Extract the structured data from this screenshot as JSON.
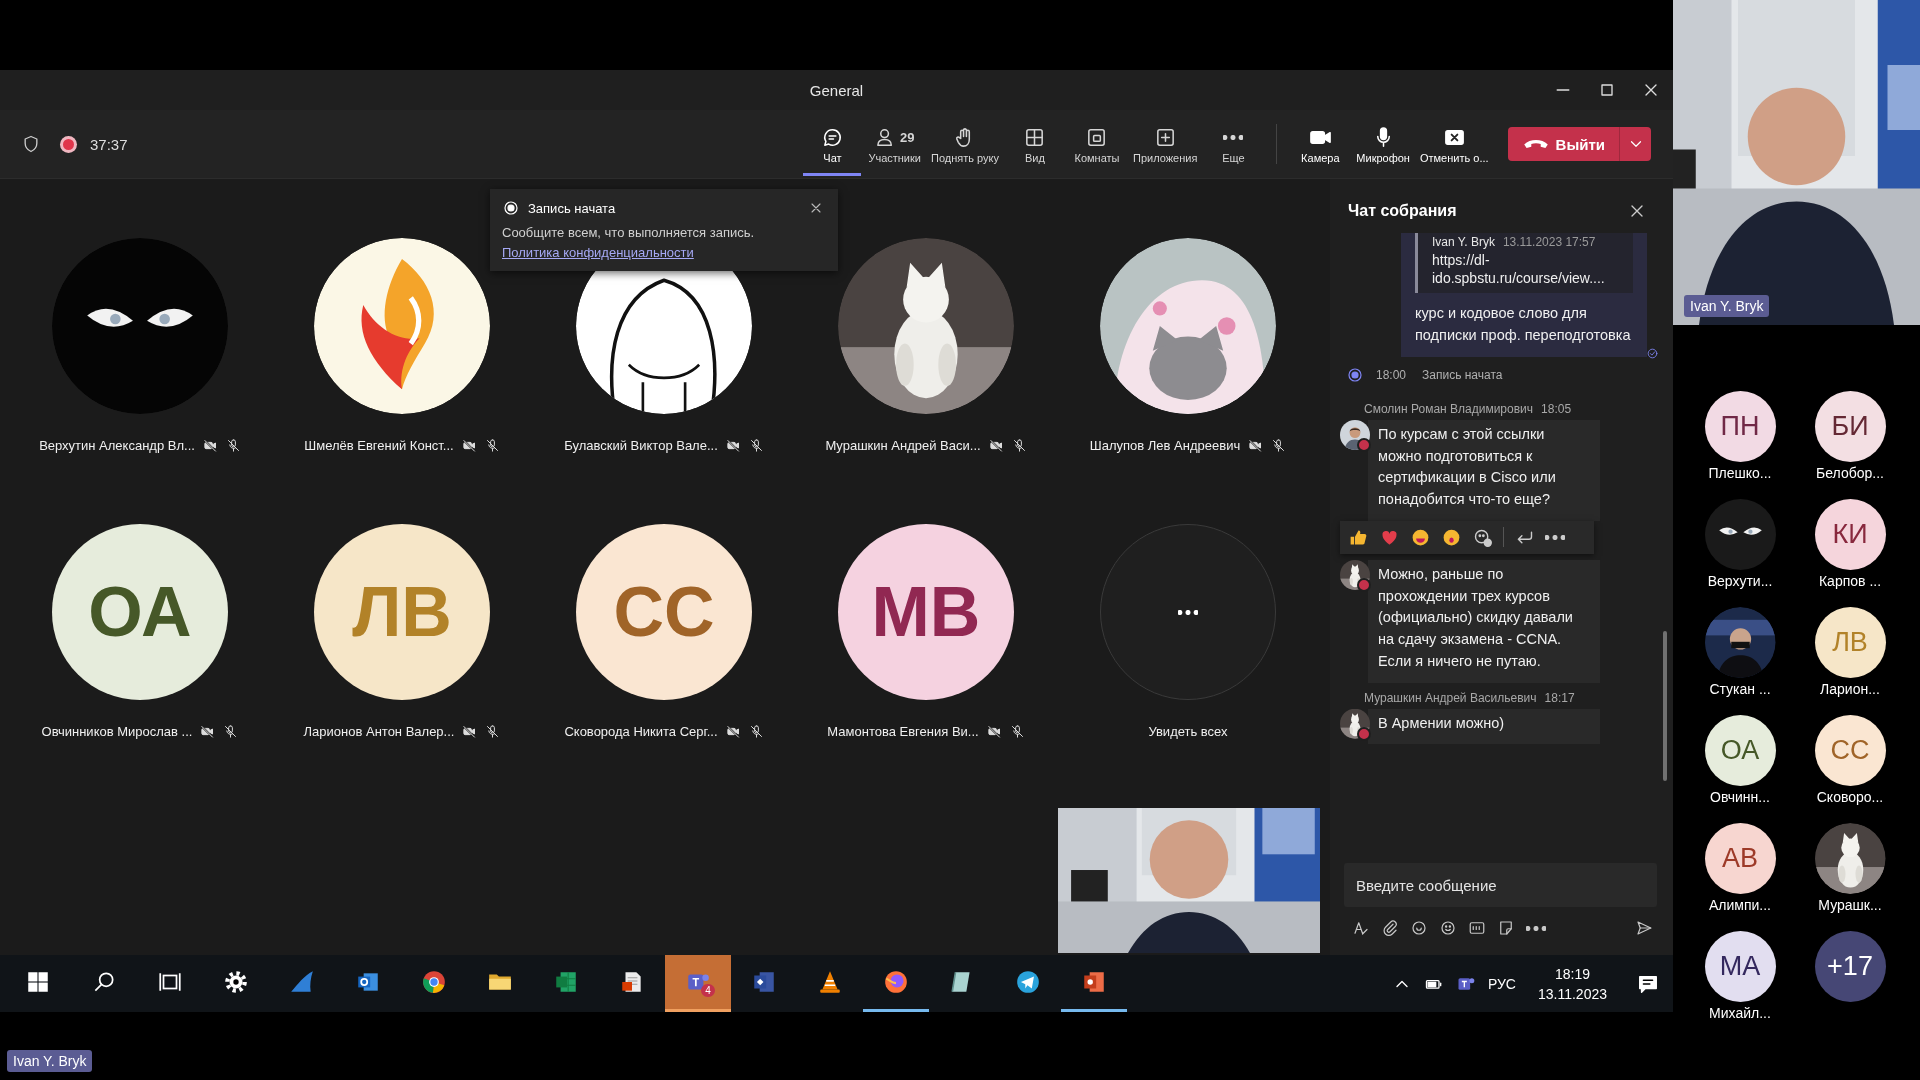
{
  "window": {
    "title": "General"
  },
  "toolbar": {
    "timer": "37:37",
    "recording": true,
    "items": [
      {
        "kind": "chat",
        "label": "Чат",
        "selected": true
      },
      {
        "kind": "people",
        "label": "Участники",
        "count": "29",
        "selected": false
      },
      {
        "kind": "hand",
        "label": "Поднять руку",
        "selected": false
      },
      {
        "kind": "view",
        "label": "Вид",
        "selected": false
      },
      {
        "kind": "rooms",
        "label": "Комнаты",
        "selected": false
      },
      {
        "kind": "apps",
        "label": "Приложения",
        "selected": false
      },
      {
        "kind": "more",
        "label": "Еще",
        "selected": false
      }
    ],
    "devices": [
      {
        "kind": "camera",
        "label": "Камера"
      },
      {
        "kind": "mic",
        "label": "Микрофон"
      },
      {
        "kind": "share",
        "label": "Отменить о..."
      }
    ],
    "leave": {
      "label": "Выйти"
    }
  },
  "toast": {
    "title": "Запись начата",
    "text": "Сообщите всем, что выполняется запись.",
    "link": "Политика конфиденциальности"
  },
  "tiles": [
    {
      "name": "Верхутин Александр Вл...",
      "kind": "picture",
      "camera_off": true,
      "muted": true
    },
    {
      "name": "Шмелёв Евгений Конст...",
      "kind": "picture",
      "camera_off": true,
      "muted": true
    },
    {
      "name": "Булавский Виктор Вале...",
      "kind": "picture",
      "camera_off": true,
      "muted": true
    },
    {
      "name": "Мурашкин Андрей Васи...",
      "kind": "picture",
      "camera_off": true,
      "muted": true
    },
    {
      "name": "Шалупов Лев Андреевич",
      "kind": "picture",
      "camera_off": true,
      "muted": true
    },
    {
      "name": "Овчинников Мирослав ...",
      "kind": "initials",
      "initials": "ОА",
      "color": "#e6ecdc",
      "camera_off": true,
      "muted": true
    },
    {
      "name": "Ларионов Антон Валер...",
      "kind": "initials",
      "initials": "ЛВ",
      "color": "#f6e6c8",
      "camera_off": true,
      "muted": true
    },
    {
      "name": "Сковорода Никита Серг...",
      "kind": "initials",
      "initials": "СС",
      "color": "#fae6d2",
      "camera_off": true,
      "muted": true
    },
    {
      "name": "Мамонтова Евгения Ви...",
      "kind": "initials",
      "initials": "МВ",
      "color": "#f5d2e0",
      "camera_off": true,
      "muted": true
    },
    {
      "name": "Увидеть всех",
      "kind": "more"
    }
  ],
  "chat": {
    "title": "Чат собрания",
    "messages": [
      {
        "kind": "own",
        "quote": {
          "author": "Ivan Y. Bryk",
          "time": "13.11.2023 17:57",
          "text": "https://dl-ido.spbstu.ru/course/view...."
        },
        "text": "курс и кодовое слово для подписки проф. переподготовка",
        "read": true
      },
      {
        "kind": "event",
        "time": "18:00",
        "text": "Запись начата"
      },
      {
        "kind": "incoming",
        "author": "Смолин Роман Владимирович",
        "time": "18:05",
        "text": "По курсам с этой ссылки можно подготовиться к сертификации в Cisco или понадобится что-то еще?",
        "busy": true,
        "hovered": true
      },
      {
        "kind": "incoming",
        "text": "Можно, раньше по прохождении трех курсов (официально) скидку давали на сдачу экзамена - CCNA. Если я ничего не путаю.",
        "busy": true,
        "hovered": false
      },
      {
        "kind": "incoming",
        "author": "Мурашкин Андрей Васильевич",
        "time": "18:17",
        "text": "В Армении можно)",
        "busy": true,
        "hovered": false
      }
    ],
    "composer": {
      "placeholder": "Введите сообщение"
    }
  },
  "taskbar": {
    "items": [
      {
        "kind": "start",
        "selected": false,
        "running": false
      },
      {
        "kind": "search",
        "selected": false,
        "running": false
      },
      {
        "kind": "taskview",
        "selected": false,
        "running": false
      },
      {
        "kind": "gear",
        "selected": false,
        "running": false
      },
      {
        "kind": "fin",
        "selected": false,
        "running": false
      },
      {
        "kind": "mail",
        "selected": false,
        "running": false
      },
      {
        "kind": "browser",
        "selected": false,
        "running": false
      },
      {
        "kind": "folder",
        "selected": false,
        "running": false
      },
      {
        "kind": "sheet",
        "selected": false,
        "running": false
      },
      {
        "kind": "document",
        "selected": false,
        "running": false
      },
      {
        "kind": "teams",
        "selected": true,
        "running": true,
        "badge": "4"
      },
      {
        "kind": "diagram",
        "selected": false,
        "running": false
      },
      {
        "kind": "cone",
        "selected": false,
        "running": false
      },
      {
        "kind": "firefox",
        "selected": false,
        "running": true
      },
      {
        "kind": "notebook",
        "selected": false,
        "running": false
      },
      {
        "kind": "plane",
        "selected": false,
        "running": false
      },
      {
        "kind": "slides",
        "selected": false,
        "running": true
      }
    ],
    "language": "РУС",
    "time": "18:19",
    "date": "13.11.2023"
  },
  "name_tag": "Ivan Y. Bryk",
  "presenter_video": {
    "name": "Ivan Y. Bryk"
  },
  "participants": [
    {
      "name": "Плешко...",
      "kind": "initials",
      "initials": "ПН",
      "color": "#f2dae4"
    },
    {
      "name": "Верхути...",
      "kind": "picture"
    },
    {
      "name": "Стукан ...",
      "kind": "picture"
    },
    {
      "name": "Овчинн...",
      "kind": "initials",
      "initials": "ОА",
      "color": "#e6ecdc"
    },
    {
      "name": "Алимпи...",
      "kind": "initials",
      "initials": "АВ",
      "color": "#f7d6d0"
    },
    {
      "name": "Михайл...",
      "kind": "initials",
      "initials": "МА",
      "color": "#e2def0"
    },
    {
      "name": "Белобор...",
      "kind": "initials",
      "initials": "БИ",
      "color": "#f3dfe3"
    },
    {
      "name": "Карпов ...",
      "kind": "initials",
      "initials": "КИ",
      "color": "#f5d5dc"
    },
    {
      "name": "Ларион...",
      "kind": "initials",
      "initials": "ЛВ",
      "color": "#f6e6c8"
    },
    {
      "name": "Сковоро...",
      "kind": "initials",
      "initials": "СС",
      "color": "#fae6d2"
    },
    {
      "name": "Мурашк...",
      "kind": "picture"
    },
    {
      "kind": "overflow",
      "label": "+17"
    }
  ]
}
